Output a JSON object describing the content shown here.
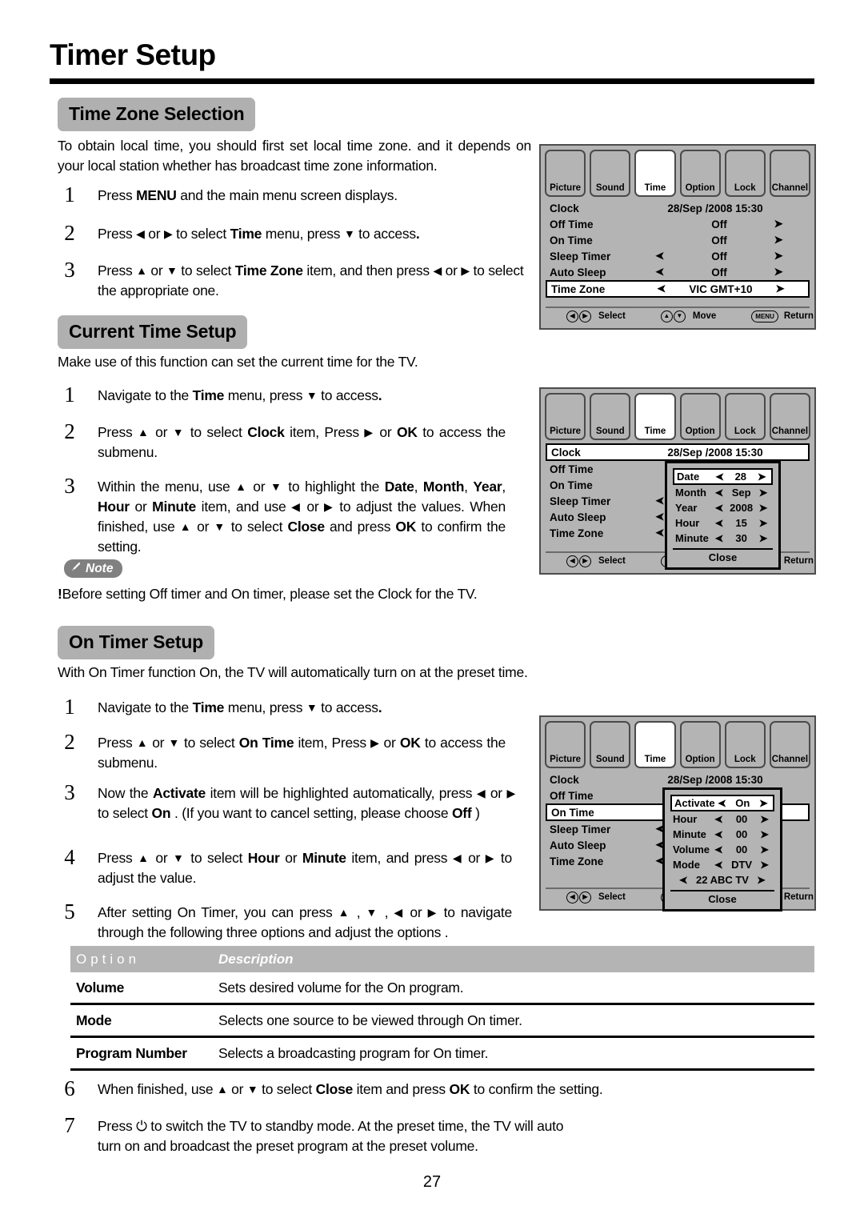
{
  "document": {
    "title": "Timer Setup",
    "page_number": "27"
  },
  "sections": {
    "time_zone": {
      "heading": "Time Zone Selection",
      "intro": "To obtain local time, you should first set local time zone. and it depends on your local station whether has broadcast time zone information.",
      "steps": [
        {
          "num": "1",
          "text_html": "Press <b>MENU</b> and the main menu screen displays."
        },
        {
          "num": "2",
          "text_html": "Press <span class=\"ar\">◀</span> or <span class=\"ar\">▶</span> to select <b>Time</b> menu,  press <span class=\"ar\">▼</span> to access<b>.</b>"
        },
        {
          "num": "3",
          "text_html": "Press <span class=\"ar\">▲</span> or <span class=\"ar\">▼</span> to select <b>Time Zone</b> item, and then press <span class=\"ar\">◀</span> or <span class=\"ar\">▶</span> to select the appropriate one."
        }
      ]
    },
    "current_time": {
      "heading": "Current Time Setup",
      "intro": "Make use of this function can set the current time for the TV.",
      "steps": [
        {
          "num": "1",
          "text_html": "Navigate to the <b>Time</b> menu,  press <span class=\"ar\">▼</span> to access<b>.</b>"
        },
        {
          "num": "2",
          "text_html": "Press <span class=\"ar\">▲</span> or <span class=\"ar\">▼</span> to select <b>Clock</b> item, Press <span class=\"ar\">▶</span> or <b>OK</b> to access the submenu."
        },
        {
          "num": "3",
          "text_html": "Within the menu, use <span class=\"ar\">▲</span> or <span class=\"ar\">▼</span> to highlight the <b>Date</b>, <b>Month</b>, <b>Year</b>, <b>Hour</b> or <b>Minute</b> item, and use <span class=\"ar\">◀</span> or <span class=\"ar\">▶</span> to adjust the values. When finished, use <span class=\"ar\">▲</span> or <span class=\"ar\">▼</span> to select <b>Close</b> and press <b>OK</b> to confirm the setting."
        }
      ],
      "note_label": "Note",
      "note_text": "Before setting Off timer and On timer, please set the Clock for the TV."
    },
    "on_timer": {
      "heading": "On Timer Setup",
      "intro": "With On Timer function On, the TV will automatically turn on at the preset time.",
      "steps": [
        {
          "num": "1",
          "text_html": "Navigate to the <b>Time</b> menu,  press <span class=\"ar\">▼</span> to access<b>.</b>"
        },
        {
          "num": "2",
          "text_html": "Press <span class=\"ar\">▲</span> or <span class=\"ar\">▼</span> to select <b>On Time</b> item, Press <span class=\"ar\">▶</span> or <b>OK</b> to access the submenu."
        },
        {
          "num": "3",
          "text_html": "Now the <b>Activate</b> item will be highlighted automatically, press <span class=\"ar\">◀</span> or <span class=\"ar\">▶</span> to select <b>On</b> . (If you want to cancel setting, please choose <b>Off</b> )"
        },
        {
          "num": "4",
          "text_html": "Press <span class=\"ar\">▲</span> or <span class=\"ar\">▼</span> to select <b>Hour</b> or <b>Minute</b> item, and press <span class=\"ar\">◀</span> or <span class=\"ar\">▶</span> to adjust the value."
        },
        {
          "num": "5",
          "text_html": "After setting On Timer, you can press <span class=\"ar\">▲</span> , <span class=\"ar\">▼</span> , <span class=\"ar\">◀</span> or <span class=\"ar\">▶</span> to navigate through the following three options and adjust the options ."
        },
        {
          "num": "6",
          "text_html": "When finished, use <span class=\"ar\">▲</span> or <span class=\"ar\">▼</span> to select <b>Close</b> item and press <b>OK</b> to confirm the setting."
        },
        {
          "num": "7",
          "text_html": "Press ⏻ to switch the TV to standby mode. At the preset time, the TV will auto turn on and broadcast the preset program at the preset volume."
        }
      ]
    }
  },
  "option_table": {
    "headers": [
      "Option",
      "Description"
    ],
    "rows": [
      {
        "option": "Volume",
        "description": "Sets desired volume for the On program."
      },
      {
        "option": "Mode",
        "description": "Selects one source to be viewed through On timer."
      },
      {
        "option": "Program Number",
        "description": "Selects a broadcasting program for On timer."
      }
    ]
  },
  "osd": {
    "tabs": [
      "Picture",
      "Sound",
      "Time",
      "Option",
      "Lock",
      "Channel"
    ],
    "selected_tab": "Time",
    "footer": {
      "select_label": "Select",
      "move_label": "Move",
      "return_label": "Return",
      "menu_button": "MENU",
      "select_icons": "◀▶",
      "move_icons": "▲▼"
    },
    "panel1": {
      "rows": [
        {
          "label": "Clock",
          "value": "28/Sep  /2008 15:30",
          "left": "",
          "right": "",
          "highlighted": false,
          "type": "clock"
        },
        {
          "label": "Off Time",
          "value": "Off",
          "left": "",
          "right": "➤",
          "highlighted": false
        },
        {
          "label": "On Time",
          "value": "Off",
          "left": "",
          "right": "➤",
          "highlighted": false
        },
        {
          "label": "Sleep Timer",
          "value": "Off",
          "left": "➤",
          "right": "➤",
          "highlighted": false
        },
        {
          "label": "Auto Sleep",
          "value": "Off",
          "left": "➤",
          "right": "➤",
          "highlighted": false
        },
        {
          "label": "Time Zone",
          "value": "VIC GMT+10",
          "left": "➤",
          "right": "➤",
          "highlighted": true
        }
      ]
    },
    "panel2": {
      "rows": [
        {
          "label": "Clock",
          "value": "28/Sep  /2008 15:30",
          "left": "",
          "right": "",
          "highlighted": true,
          "type": "clock"
        },
        {
          "label": "Off Time",
          "value": "",
          "left": "",
          "right": "",
          "highlighted": false
        },
        {
          "label": "On Time",
          "value": "",
          "left": "",
          "right": "",
          "highlighted": false
        },
        {
          "label": "Sleep Timer",
          "value": "",
          "left": "➤",
          "right": "",
          "highlighted": false
        },
        {
          "label": "Auto Sleep",
          "value": "",
          "left": "➤",
          "right": "",
          "highlighted": false
        },
        {
          "label": "Time Zone",
          "value": "",
          "left": "➤",
          "right": "",
          "highlighted": false
        }
      ],
      "submenu": {
        "items": [
          {
            "label": "Date",
            "value": "28",
            "highlighted": true
          },
          {
            "label": "Month",
            "value": "Sep",
            "highlighted": false
          },
          {
            "label": "Year",
            "value": "2008",
            "highlighted": false
          },
          {
            "label": "Hour",
            "value": "15",
            "highlighted": false
          },
          {
            "label": "Minute",
            "value": "30",
            "highlighted": false
          }
        ],
        "close_label": "Close"
      }
    },
    "panel3": {
      "rows": [
        {
          "label": "Clock",
          "value": "28/Sep  /2008 15:30",
          "left": "",
          "right": "",
          "highlighted": false,
          "type": "clock"
        },
        {
          "label": "Off Time",
          "value": "",
          "left": "",
          "right": "",
          "highlighted": false
        },
        {
          "label": "On Time",
          "value": "",
          "left": "",
          "right": "",
          "highlighted": true
        },
        {
          "label": "Sleep Timer",
          "value": "",
          "left": "➤",
          "right": "",
          "highlighted": false
        },
        {
          "label": "Auto Sleep",
          "value": "",
          "left": "➤",
          "right": "",
          "highlighted": false
        },
        {
          "label": "Time Zone",
          "value": "",
          "left": "➤",
          "right": "",
          "highlighted": false
        }
      ],
      "submenu": {
        "items": [
          {
            "label": "Activate",
            "value": "On",
            "highlighted": true
          },
          {
            "label": "Hour",
            "value": "00",
            "highlighted": false
          },
          {
            "label": "Minute",
            "value": "00",
            "highlighted": false
          },
          {
            "label": "Volume",
            "value": "00",
            "highlighted": false
          },
          {
            "label": "Mode",
            "value": "DTV",
            "highlighted": false
          }
        ],
        "program": "22 ABC TV",
        "close_label": "Close"
      }
    }
  }
}
